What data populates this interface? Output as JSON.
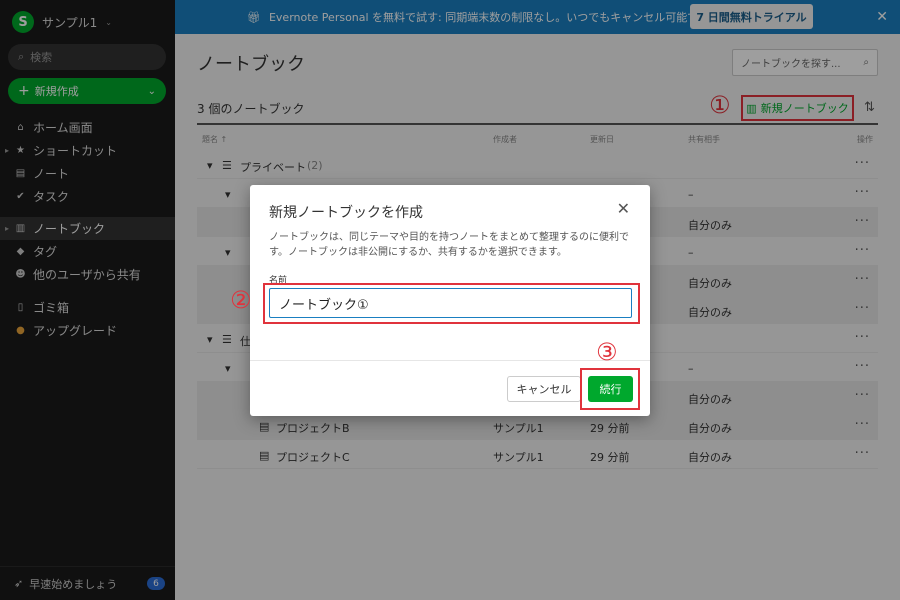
{
  "sidebar": {
    "account": "サンプル1",
    "account_logo": "S",
    "search_placeholder": "検索",
    "new_button": "新規作成",
    "items": [
      {
        "label": "ホーム画面",
        "icon": "home-icon"
      },
      {
        "label": "ショートカット",
        "icon": "star-icon"
      },
      {
        "label": "ノート",
        "icon": "note-icon"
      },
      {
        "label": "タスク",
        "icon": "check-circle-icon"
      },
      {
        "label": "ノートブック",
        "icon": "notebook-icon"
      },
      {
        "label": "タグ",
        "icon": "tag-icon"
      },
      {
        "label": "他のユーザから共有",
        "icon": "people-icon"
      },
      {
        "label": "ゴミ箱",
        "icon": "trash-icon"
      },
      {
        "label": "アップグレード",
        "icon": "upgrade-icon"
      }
    ],
    "bottom_label": "早速始めましょう",
    "bottom_badge": "6"
  },
  "banner": {
    "message": "Evernote Personal を無料で試す: 同期端末数の制限なし。いつでもキャンセル可能です。",
    "trial_button": "7 日間無料トライアル"
  },
  "main": {
    "title": "ノートブック",
    "search_placeholder": "ノートブックを探す...",
    "count": "3 個のノートブック",
    "new_notebook": "新規ノートブック",
    "columns": [
      "題名 ↑",
      "作成者",
      "更新日",
      "共有相手",
      "操作"
    ],
    "rows": [
      {
        "title": "プライベート",
        "count": "(2)",
        "creator": "",
        "updated": "",
        "shared": ""
      },
      {
        "title": "",
        "creator": "",
        "updated": "",
        "shared": "–"
      },
      {
        "title": "",
        "creator": "",
        "updated": "",
        "shared": "自分のみ"
      },
      {
        "title": "",
        "creator": "",
        "updated": "",
        "shared": "–"
      },
      {
        "title": "",
        "creator": "",
        "updated": "",
        "shared": "自分のみ"
      },
      {
        "title": "",
        "creator": "",
        "updated": "",
        "shared": "自分のみ"
      },
      {
        "title": "仕",
        "creator": "",
        "updated": "",
        "shared": ""
      },
      {
        "title": "",
        "creator": "",
        "updated": "",
        "shared": "–"
      },
      {
        "title": "",
        "creator": "",
        "updated": "",
        "shared": "自分のみ"
      },
      {
        "title": "プロジェクトB",
        "creator": "サンプル1",
        "updated": "29 分前",
        "shared": "自分のみ"
      },
      {
        "title": "プロジェクトC",
        "creator": "サンプル1",
        "updated": "29 分前",
        "shared": "自分のみ"
      }
    ]
  },
  "modal": {
    "title": "新規ノートブックを作成",
    "description": "ノートブックは、同じテーマや目的を持つノートをまとめて整理するのに便利です。ノートブックは非公開にするか、共有するかを選択できます。",
    "name_label": "名前",
    "name_value": "ノートブック①",
    "cancel": "キャンセル",
    "continue": "続行"
  },
  "markers": [
    "①",
    "②",
    "③"
  ],
  "colors": {
    "accent": "#00a82d",
    "banner": "#1a7fc1",
    "annotation": "#e0333c"
  }
}
